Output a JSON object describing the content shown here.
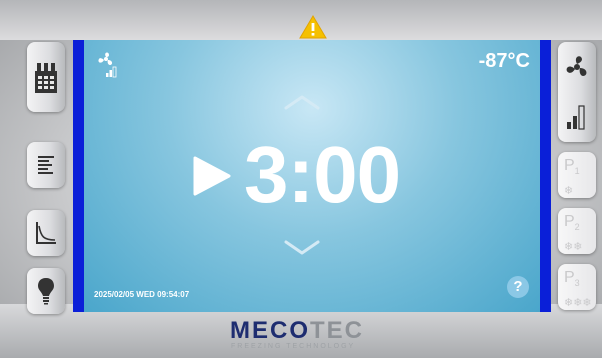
{
  "display": {
    "temperature": "-87°C",
    "timer": "3:00",
    "datetime": "2025/02/05 WED 09:54:07",
    "help_label": "?"
  },
  "presets": [
    {
      "label": "P",
      "sub": "1",
      "snow": "❄"
    },
    {
      "label": "P",
      "sub": "2",
      "snow": "❄❄"
    },
    {
      "label": "P",
      "sub": "3",
      "snow": "❄❄❄"
    }
  ],
  "brand": {
    "logo_part1": "MECO",
    "logo_part2": "TEC",
    "tagline": "FREEZING TECHNOLOGY"
  },
  "icons": {
    "left_buttons": [
      "calendar-icon",
      "list-icon",
      "graph-icon",
      "bulb-icon"
    ],
    "right_buttons": [
      "fan-icon",
      "signal-level-icon"
    ],
    "top": "warning-icon"
  },
  "colors": {
    "accent_blue": "#0a1fd8",
    "warning_yellow": "#f5c000",
    "screen_blue": "#4aa6cb"
  }
}
